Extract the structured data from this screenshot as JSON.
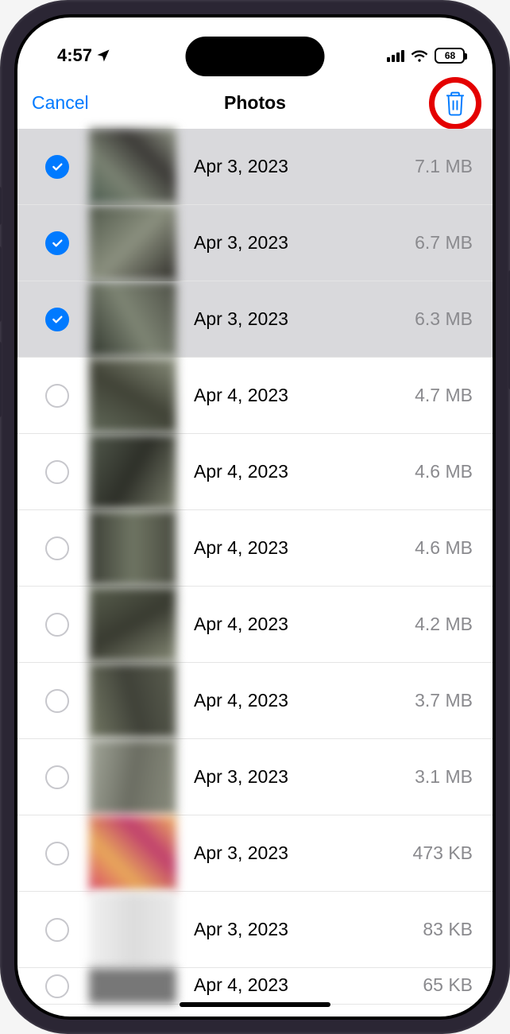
{
  "status": {
    "time": "4:57",
    "battery": "68"
  },
  "nav": {
    "cancel": "Cancel",
    "title": "Photos"
  },
  "photos": [
    {
      "selected": true,
      "date": "Apr 3, 2023",
      "size": "7.1 MB",
      "thumbClass": "t1"
    },
    {
      "selected": true,
      "date": "Apr 3, 2023",
      "size": "6.7 MB",
      "thumbClass": "t2"
    },
    {
      "selected": true,
      "date": "Apr 3, 2023",
      "size": "6.3 MB",
      "thumbClass": "t3"
    },
    {
      "selected": false,
      "date": "Apr 4, 2023",
      "size": "4.7 MB",
      "thumbClass": "t4"
    },
    {
      "selected": false,
      "date": "Apr 4, 2023",
      "size": "4.6 MB",
      "thumbClass": "t5"
    },
    {
      "selected": false,
      "date": "Apr 4, 2023",
      "size": "4.6 MB",
      "thumbClass": "t6"
    },
    {
      "selected": false,
      "date": "Apr 4, 2023",
      "size": "4.2 MB",
      "thumbClass": "t7"
    },
    {
      "selected": false,
      "date": "Apr 4, 2023",
      "size": "3.7 MB",
      "thumbClass": "t8"
    },
    {
      "selected": false,
      "date": "Apr 3, 2023",
      "size": "3.1 MB",
      "thumbClass": "t9"
    },
    {
      "selected": false,
      "date": "Apr 3, 2023",
      "size": "473 KB",
      "thumbClass": "t10"
    },
    {
      "selected": false,
      "date": "Apr 3, 2023",
      "size": "83 KB",
      "thumbClass": "t11"
    },
    {
      "selected": false,
      "date": "Apr 4, 2023",
      "size": "65 KB",
      "thumbClass": "t12",
      "partial": true
    }
  ],
  "colors": {
    "accent": "#007AFF",
    "highlight": "#e40000"
  }
}
